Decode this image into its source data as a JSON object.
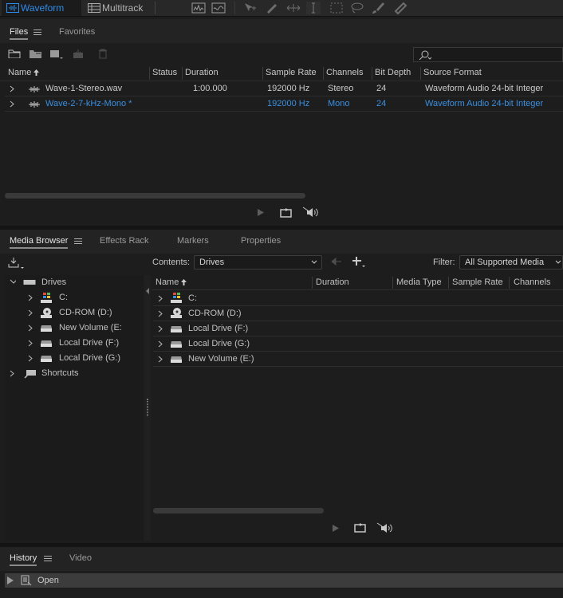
{
  "toolbar": {
    "waveform_label": "Waveform",
    "multitrack_label": "Multitrack",
    "tools": [
      "spectral-frequency-icon",
      "spectral-pitch-icon",
      "move-tool-icon",
      "razor-tool-icon",
      "slip-tool-icon",
      "time-selection-icon",
      "marquee-selection-icon",
      "lasso-selection-icon",
      "brush-selection-icon",
      "spot-healing-icon"
    ]
  },
  "files_panel": {
    "tabs": [
      "Files",
      "Favorites"
    ],
    "search_placeholder": "",
    "columns": [
      "Name",
      "Status",
      "Duration",
      "Sample Rate",
      "Channels",
      "Bit Depth",
      "Source Format"
    ],
    "rows": [
      {
        "name": "Wave-1-Stereo.wav",
        "status": "",
        "duration": "1:00.000",
        "sample_rate": "192000 Hz",
        "channels": "Stereo",
        "bit_depth": "24",
        "source_format": "Waveform Audio 24-bit Integer",
        "selected": false
      },
      {
        "name": "Wave-2-7-kHz-Mono *",
        "status": "",
        "duration": "",
        "sample_rate": "192000 Hz",
        "channels": "Mono",
        "bit_depth": "24",
        "source_format": "Waveform Audio 24-bit Integer",
        "selected": true
      }
    ]
  },
  "media_panel": {
    "tabs": [
      "Media Browser",
      "Effects Rack",
      "Markers",
      "Properties"
    ],
    "contents_label": "Contents:",
    "contents_value": "Drives",
    "filter_label": "Filter:",
    "filter_value": "All Supported Media",
    "tree": {
      "drives_label": "Drives",
      "drives": [
        "C:",
        "CD-ROM (D:)",
        "New Volume (E:",
        "Local Drive (F:)",
        "Local Drive (G:)"
      ],
      "shortcuts_label": "Shortcuts"
    },
    "columns": [
      "Name",
      "Duration",
      "Media Type",
      "Sample Rate",
      "Channels"
    ],
    "rows": [
      "C:",
      "CD-ROM (D:)",
      "Local Drive (F:)",
      "Local Drive (G:)",
      "New Volume (E:)"
    ]
  },
  "history_panel": {
    "tabs": [
      "History",
      "Video"
    ],
    "items": [
      "Open"
    ]
  },
  "colors": {
    "accent": "#2d8ceb",
    "selected_text": "#3a8fe0",
    "panel_bg": "#1d1d1d",
    "header_bg": "#232323"
  }
}
